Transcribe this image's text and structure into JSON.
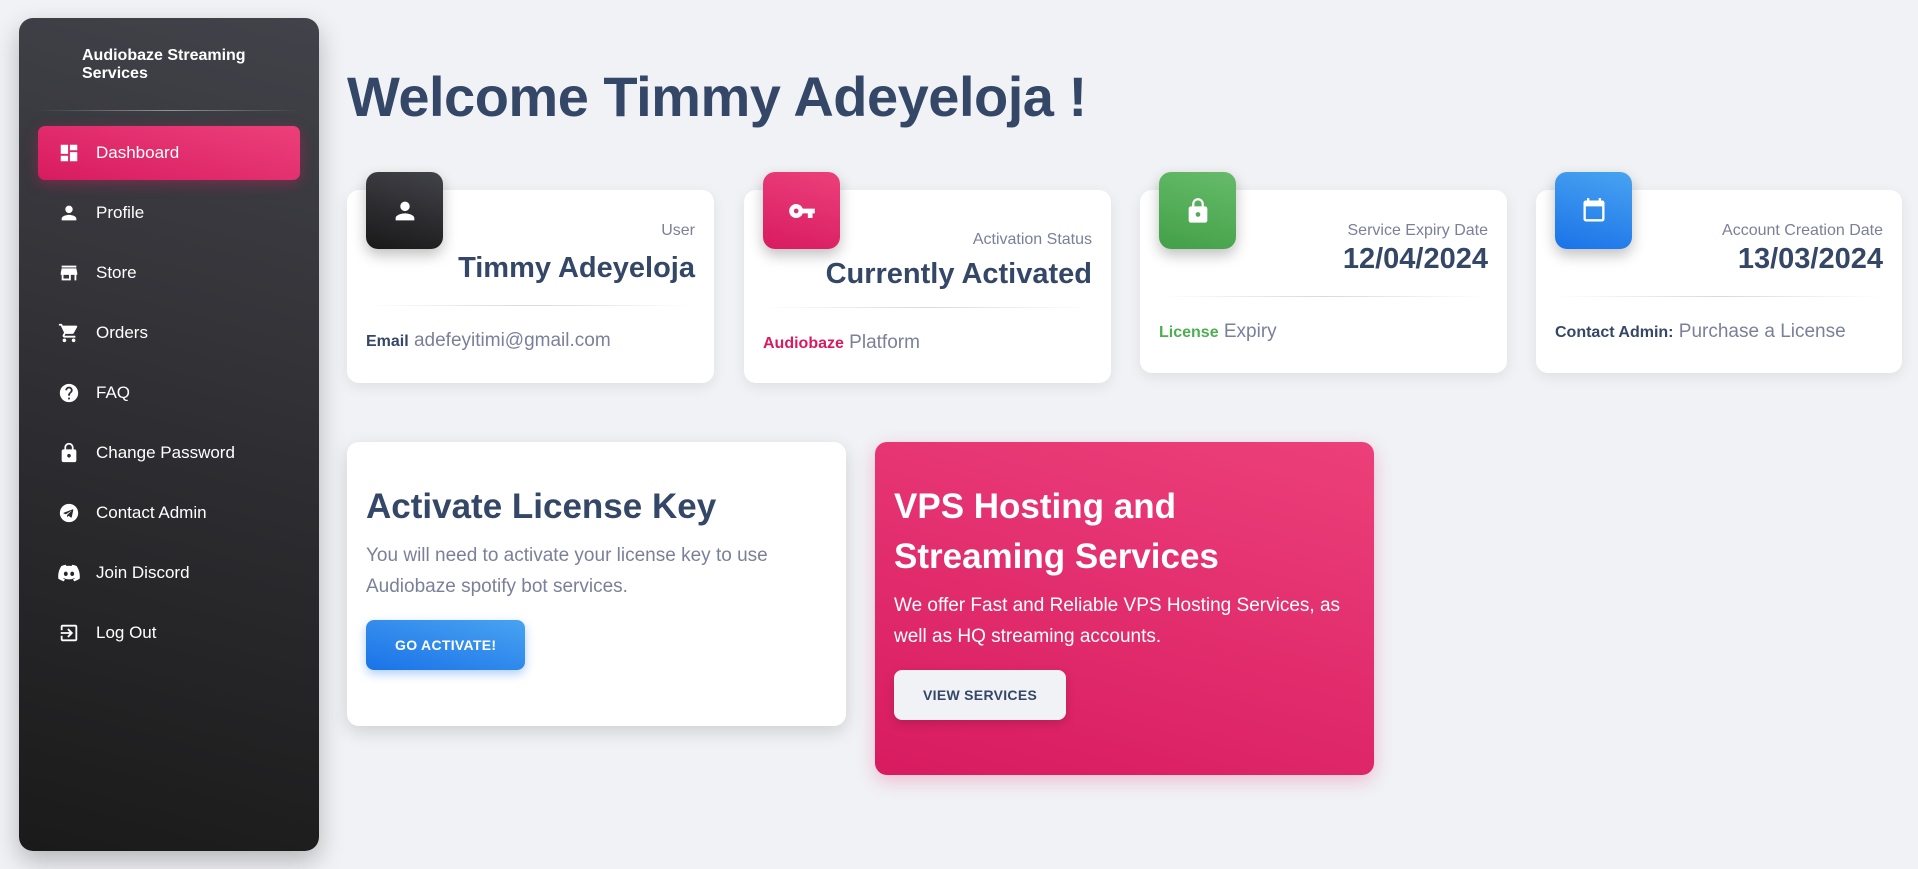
{
  "sidebar": {
    "brand": "Audiobaze Streaming Services",
    "items": [
      {
        "label": "Dashboard",
        "icon": "dashboard-icon",
        "active": true
      },
      {
        "label": "Profile",
        "icon": "person-icon"
      },
      {
        "label": "Store",
        "icon": "store-icon"
      },
      {
        "label": "Orders",
        "icon": "cart-icon"
      },
      {
        "label": "FAQ",
        "icon": "help-icon"
      },
      {
        "label": "Change Password",
        "icon": "lock-icon"
      },
      {
        "label": "Contact Admin",
        "icon": "telegram-icon"
      },
      {
        "label": "Join Discord",
        "icon": "discord-icon"
      },
      {
        "label": "Log Out",
        "icon": "logout-icon"
      }
    ]
  },
  "main": {
    "welcome": "Welcome Timmy Adeyeloja !",
    "stats": [
      {
        "label": "User",
        "value": "Timmy Adeyeloja",
        "foot_bold": "Email",
        "foot_text": "adefeyitimi@gmail.com",
        "foot_color": "#344767",
        "icon": "person-icon",
        "color": "dark"
      },
      {
        "label": "Activation Status",
        "value": "Currently Activated",
        "foot_bold": "Audiobaze",
        "foot_text": "Platform",
        "foot_color": "#d81b60",
        "icon": "key-icon",
        "color": "pink"
      },
      {
        "label": "Service Expiry Date",
        "value": "12/04/2024",
        "foot_bold": "License",
        "foot_text": "Expiry",
        "foot_color": "#4caf50",
        "icon": "lock-icon",
        "color": "green"
      },
      {
        "label": "Account Creation Date",
        "value": "13/03/2024",
        "foot_bold": "Contact Admin:",
        "foot_text": "Purchase a License",
        "foot_color": "#344767",
        "icon": "calendar-icon",
        "color": "blue"
      }
    ],
    "license_card": {
      "title": "Activate License Key",
      "text": "You will need to activate your license key to use Audiobaze spotify bot services.",
      "button": "GO ACTIVATE!"
    },
    "vps_card": {
      "title": "VPS Hosting and Streaming Services",
      "text": "We offer Fast and Reliable VPS Hosting Services, as well as HQ streaming accounts.",
      "button": "VIEW SERVICES"
    }
  },
  "colors": {
    "primary": "#e91e63",
    "info": "#1a73e8",
    "success": "#4caf50",
    "dark": "#344767"
  }
}
